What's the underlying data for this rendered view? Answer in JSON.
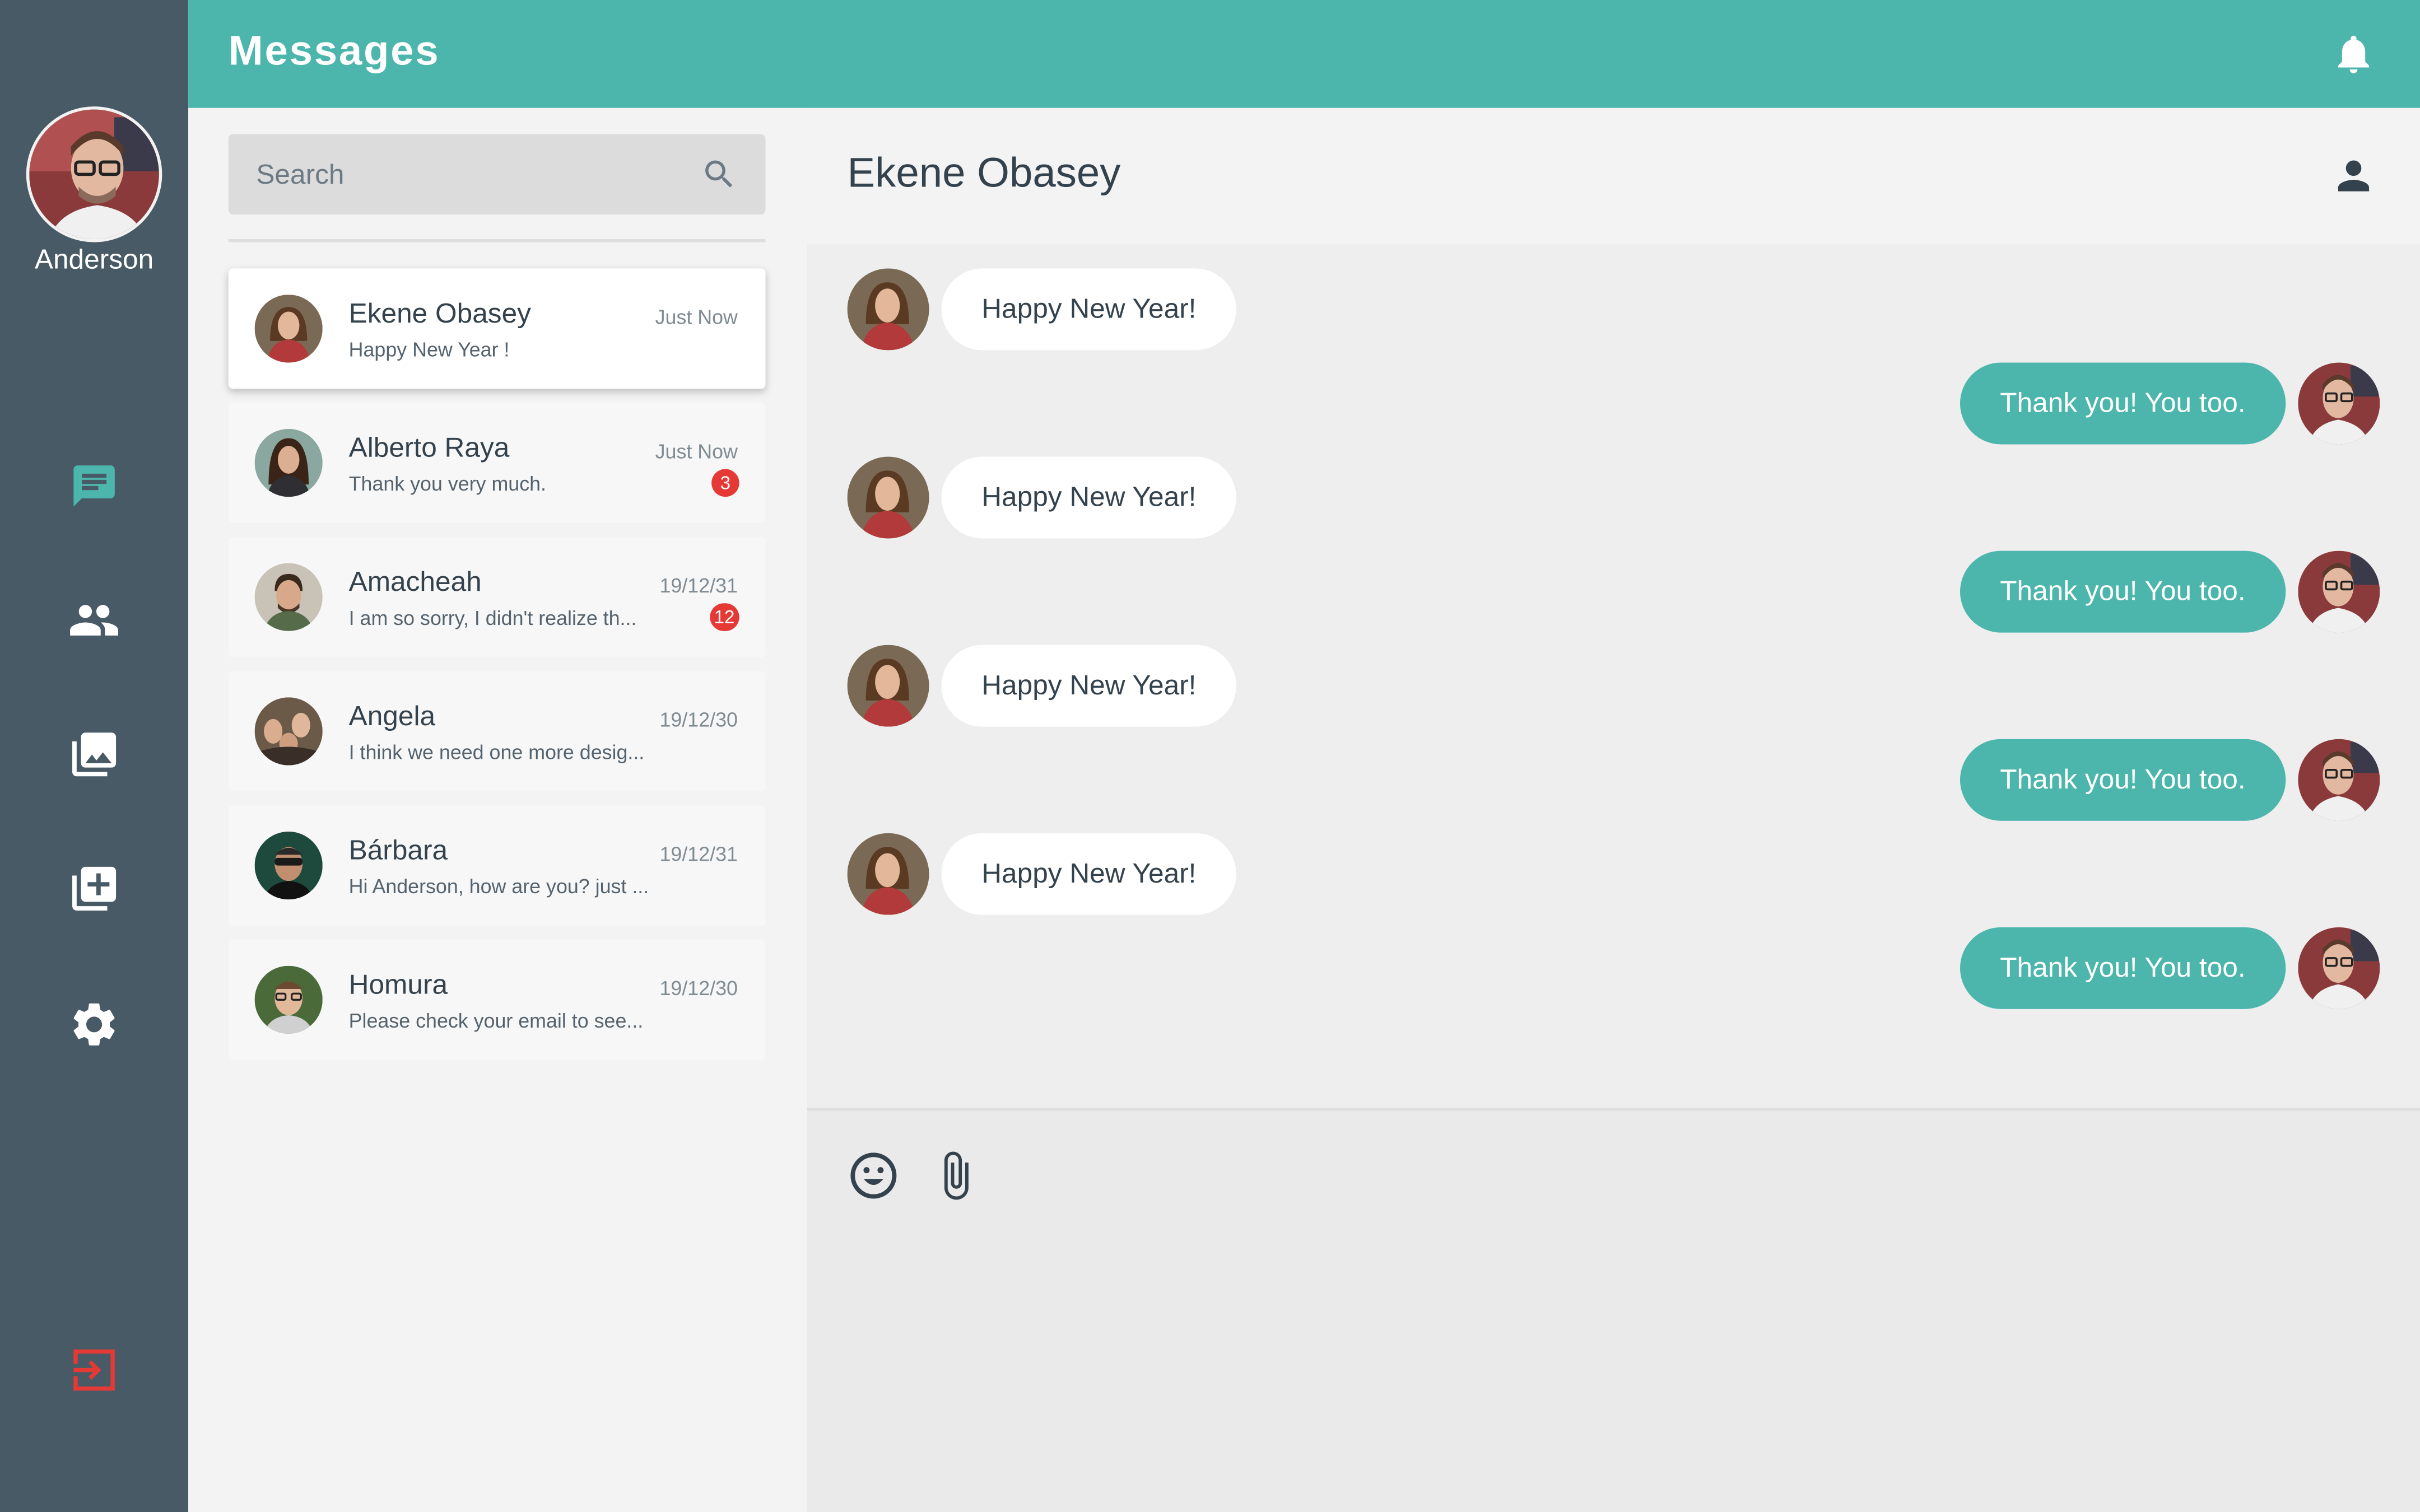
{
  "app": {
    "title": "Messages",
    "accent_color": "#4db6ac",
    "sidebar_color": "#495a67",
    "danger_color": "#e53935"
  },
  "user": {
    "name": "Anderson"
  },
  "nav": [
    {
      "id": "chat",
      "icon": "chat-icon",
      "active": true
    },
    {
      "id": "contacts",
      "icon": "people-icon",
      "active": false
    },
    {
      "id": "gallery",
      "icon": "photo-library-icon",
      "active": false
    },
    {
      "id": "add",
      "icon": "library-add-icon",
      "active": false
    },
    {
      "id": "settings",
      "icon": "gear-icon",
      "active": false
    },
    {
      "id": "logout",
      "icon": "logout-icon",
      "active": false
    }
  ],
  "search": {
    "placeholder": "Search",
    "value": ""
  },
  "conversations": [
    {
      "name": "Ekene Obasey",
      "time": "Just Now",
      "preview": "Happy New Year !",
      "badge": ""
    },
    {
      "name": "Alberto Raya",
      "time": "Just Now",
      "preview": "Thank you very much.",
      "badge": "3"
    },
    {
      "name": "Amacheah",
      "time": "19/12/31",
      "preview": "I am so sorry, I didn't realize th...",
      "badge": "12"
    },
    {
      "name": "Angela",
      "time": "19/12/30",
      "preview": "I think we need one more desig...",
      "badge": ""
    },
    {
      "name": "Bárbara",
      "time": "19/12/31",
      "preview": "Hi Anderson, how are you? just ...",
      "badge": ""
    },
    {
      "name": "Homura",
      "time": "19/12/30",
      "preview": "Please check your email to see...",
      "badge": ""
    }
  ],
  "chat": {
    "title": "Ekene Obasey",
    "messages": [
      {
        "dir": "in",
        "text": "Happy New Year!"
      },
      {
        "dir": "out",
        "text": "Thank you! You too."
      },
      {
        "dir": "in",
        "text": "Happy New Year!"
      },
      {
        "dir": "out",
        "text": "Thank you! You too."
      },
      {
        "dir": "in",
        "text": "Happy New Year!"
      },
      {
        "dir": "out",
        "text": "Thank you! You too."
      },
      {
        "dir": "in",
        "text": "Happy New Year!"
      },
      {
        "dir": "out",
        "text": "Thank you! You too."
      }
    ]
  },
  "composer": {
    "tools": [
      "emoji-icon",
      "attach-icon"
    ]
  }
}
